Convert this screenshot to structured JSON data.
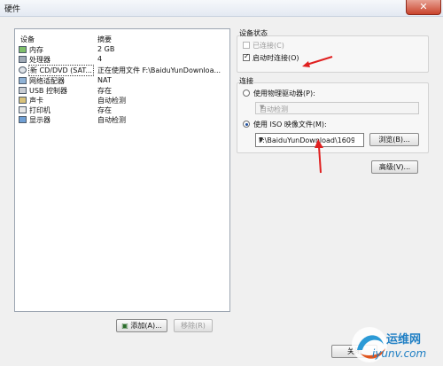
{
  "window": {
    "title": "硬件",
    "close_label": "✕"
  },
  "device_list": {
    "headers": {
      "device": "设备",
      "summary": "摘要"
    },
    "rows": [
      {
        "name": "内存",
        "summary": "2 GB",
        "icon": "memory-icon"
      },
      {
        "name": "处理器",
        "summary": "4",
        "icon": "processor-icon"
      },
      {
        "name": "新 CD/DVD (SAT...",
        "summary": "正在使用文件 F:\\BaiduYunDownloa...",
        "icon": "cd-dvd-icon"
      },
      {
        "name": "网络适配器",
        "summary": "NAT",
        "icon": "network-icon"
      },
      {
        "name": "USB 控制器",
        "summary": "存在",
        "icon": "usb-icon"
      },
      {
        "name": "声卡",
        "summary": "自动检测",
        "icon": "sound-icon"
      },
      {
        "name": "打印机",
        "summary": "存在",
        "icon": "printer-icon"
      },
      {
        "name": "显示器",
        "summary": "自动检测",
        "icon": "display-icon"
      }
    ],
    "add_button": "添加(A)...",
    "remove_button": "移除(R)"
  },
  "device_status": {
    "title": "设备状态",
    "connected": {
      "label": "已连接(C)",
      "checked": false,
      "disabled": true
    },
    "connect_on_power": {
      "label": "启动时连接(O)",
      "checked": true
    }
  },
  "connection": {
    "title": "连接",
    "physical": {
      "label": "使用物理驱动器(P):",
      "selected": false,
      "dropdown_value": "自动检测"
    },
    "iso": {
      "label": "使用 ISO 映像文件(M):",
      "selected": true,
      "path_value": "F:\\BaiduYunDownload\\1609"
    },
    "browse_button": "浏览(B)..."
  },
  "advanced_button": "高级(V)...",
  "footer": {
    "close_button": "关闭"
  },
  "watermark": {
    "brand_cn": "运维网",
    "url": "iyunv.com"
  },
  "colors": {
    "annotation_arrow": "#e02020",
    "iso_field_border": "#7a7a7a"
  }
}
